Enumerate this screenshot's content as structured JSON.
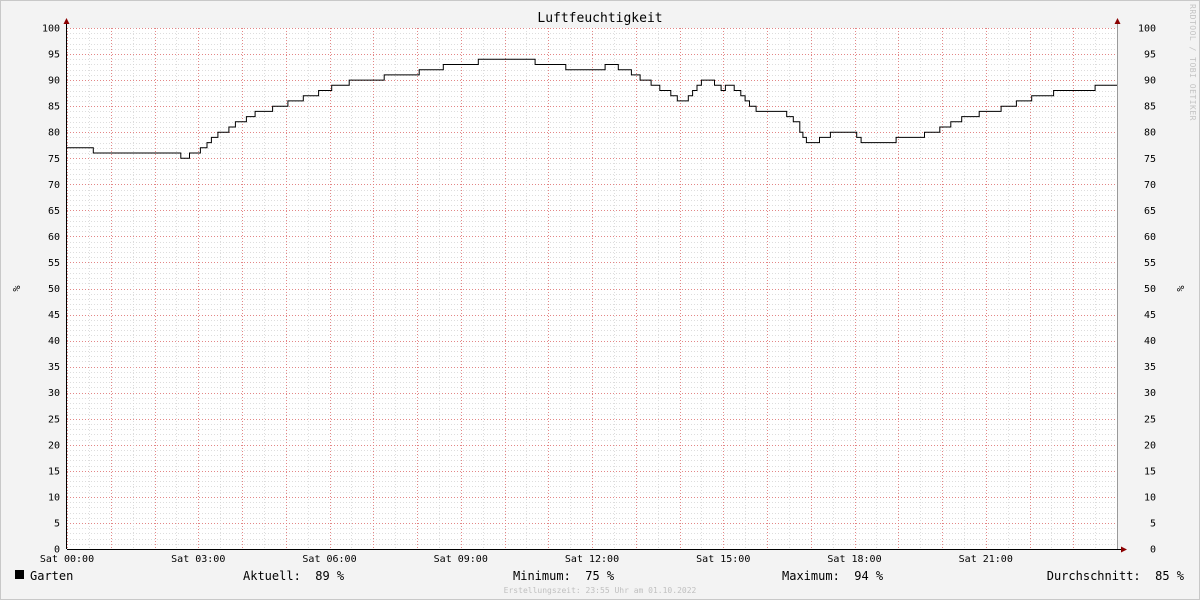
{
  "chart_data": {
    "type": "line",
    "title": "Luftfeuchtigkeit",
    "ylabel": "%",
    "ylim": [
      0,
      100
    ],
    "y_ticks": [
      0,
      5,
      10,
      15,
      20,
      25,
      30,
      35,
      40,
      45,
      50,
      55,
      60,
      65,
      70,
      75,
      80,
      85,
      90,
      95,
      100
    ],
    "xlim_hours": [
      0,
      24
    ],
    "x_ticks": [
      {
        "hour": 0,
        "label": "Sat 00:00"
      },
      {
        "hour": 3,
        "label": "Sat 03:00"
      },
      {
        "hour": 6,
        "label": "Sat 06:00"
      },
      {
        "hour": 9,
        "label": "Sat 09:00"
      },
      {
        "hour": 12,
        "label": "Sat 12:00"
      },
      {
        "hour": 15,
        "label": "Sat 15:00"
      },
      {
        "hour": 18,
        "label": "Sat 18:00"
      },
      {
        "hour": 21,
        "label": "Sat 21:00"
      }
    ],
    "grid": true,
    "series": [
      {
        "name": "Garten",
        "color": "#000000",
        "points": [
          [
            0.0,
            77
          ],
          [
            0.6,
            76
          ],
          [
            2.6,
            75
          ],
          [
            2.8,
            76
          ],
          [
            3.05,
            77
          ],
          [
            3.2,
            78
          ],
          [
            3.3,
            79
          ],
          [
            3.45,
            80
          ],
          [
            3.7,
            81
          ],
          [
            3.85,
            82
          ],
          [
            4.1,
            83
          ],
          [
            4.3,
            84
          ],
          [
            4.7,
            85
          ],
          [
            5.05,
            86
          ],
          [
            5.4,
            87
          ],
          [
            5.75,
            88
          ],
          [
            6.05,
            89
          ],
          [
            6.45,
            90
          ],
          [
            7.25,
            91
          ],
          [
            8.05,
            92
          ],
          [
            8.6,
            93
          ],
          [
            9.4,
            94
          ],
          [
            10.7,
            93
          ],
          [
            11.4,
            92
          ],
          [
            12.3,
            93
          ],
          [
            12.6,
            92
          ],
          [
            12.9,
            91
          ],
          [
            13.1,
            90
          ],
          [
            13.35,
            89
          ],
          [
            13.55,
            88
          ],
          [
            13.8,
            87
          ],
          [
            13.95,
            86
          ],
          [
            14.2,
            87
          ],
          [
            14.3,
            88
          ],
          [
            14.4,
            89
          ],
          [
            14.5,
            90
          ],
          [
            14.8,
            89
          ],
          [
            14.95,
            88
          ],
          [
            15.05,
            89
          ],
          [
            15.25,
            88
          ],
          [
            15.4,
            87
          ],
          [
            15.5,
            86
          ],
          [
            15.6,
            85
          ],
          [
            15.75,
            84
          ],
          [
            16.45,
            83
          ],
          [
            16.6,
            82
          ],
          [
            16.75,
            80
          ],
          [
            16.82,
            79
          ],
          [
            16.9,
            78
          ],
          [
            17.2,
            79
          ],
          [
            17.45,
            80
          ],
          [
            18.05,
            79
          ],
          [
            18.15,
            78
          ],
          [
            18.95,
            79
          ],
          [
            19.6,
            80
          ],
          [
            19.95,
            81
          ],
          [
            20.2,
            82
          ],
          [
            20.45,
            83
          ],
          [
            20.85,
            84
          ],
          [
            21.35,
            85
          ],
          [
            21.7,
            86
          ],
          [
            22.05,
            87
          ],
          [
            22.55,
            88
          ],
          [
            23.5,
            89
          ],
          [
            24.0,
            89
          ]
        ]
      }
    ]
  },
  "legend": {
    "series_name": "Garten",
    "current": "Aktuell:  89 %",
    "minimum": "Minimum:  75 %",
    "maximum": "Maximum:  94 %",
    "average": "Durchschnitt:  85 %"
  },
  "footer": "Erstellungszeit: 23:55 Uhr am 01.10.2022",
  "watermark": "RRDTOOL / TOBI OETIKER",
  "colors": {
    "background": "#f3f3f3",
    "plot_background": "#ffffff",
    "major_grid": "#e07a7a",
    "minor_grid": "#cfcfcf",
    "axis": "#000000",
    "arrow": "#8b0000"
  }
}
